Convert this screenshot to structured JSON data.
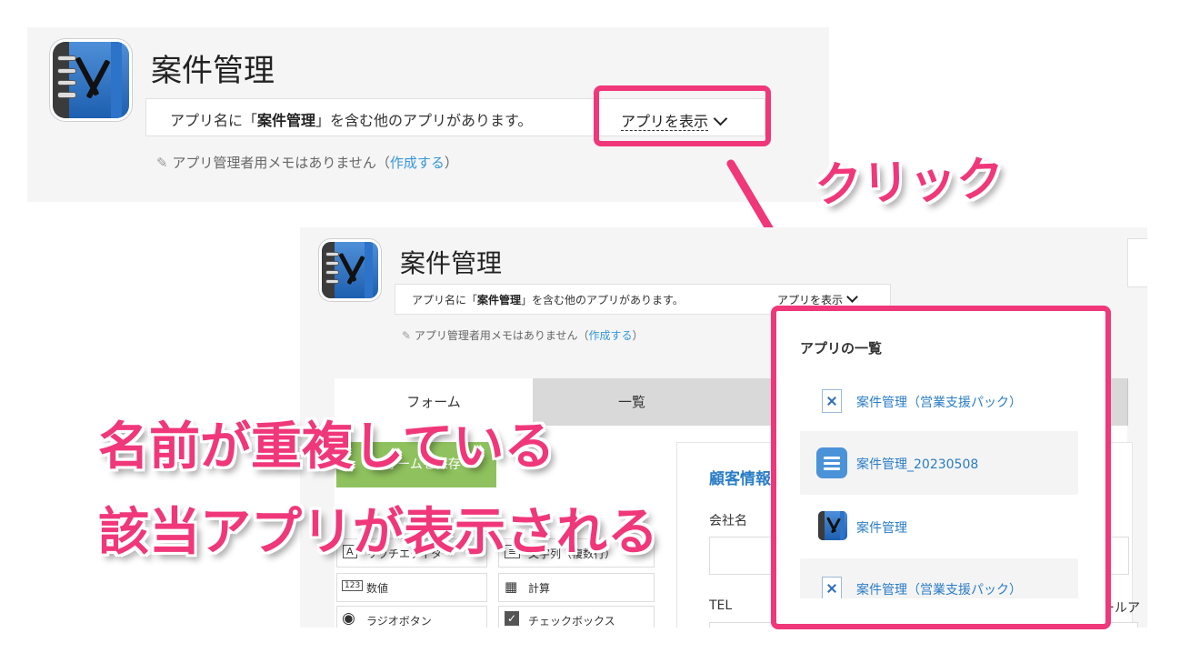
{
  "app": {
    "title": "案件管理",
    "notice_prefix": "アプリ名に「",
    "notice_name": "案件管理",
    "notice_suffix": "」を含む他のアプリがあります。",
    "show_apps": "アプリを表示",
    "memo_text": "アプリ管理者用メモはありません（",
    "memo_link": "作成する",
    "memo_close": "）"
  },
  "annotations": {
    "click": "クリック",
    "line1": "名前が重複している",
    "line2": "該当アプリが表示される"
  },
  "tabs": [
    "フォーム",
    "一覧"
  ],
  "form": {
    "save_button": "フォームを保存",
    "section_title": "顧客情報",
    "company_label": "会社名",
    "tel_label": "TEL",
    "mail_label_partial": "ールア"
  },
  "palette": [
    {
      "icon": "A",
      "label": "リッチエディター"
    },
    {
      "icon": "≡",
      "label": "文字列（複数行）"
    },
    {
      "icon": "123",
      "label": "数値"
    },
    {
      "icon": "▦",
      "label": "計算"
    },
    {
      "icon": "◉",
      "label": "ラジオボタン"
    },
    {
      "icon": "✓",
      "label": "チェックボックス"
    }
  ],
  "app_list": {
    "heading": "アプリの一覧",
    "items": [
      {
        "label": "案件管理（営業支援パック）",
        "icon": "doc-icon"
      },
      {
        "label": "案件管理_20230508",
        "icon": "list-icon"
      },
      {
        "label": "案件管理",
        "icon": "notebook-icon"
      },
      {
        "label": "案件管理（営業支援パック）",
        "icon": "doc-icon"
      }
    ]
  },
  "colors": {
    "highlight": "#f0377a",
    "link": "#2a7dc6",
    "save_button": "#8fc25e"
  }
}
